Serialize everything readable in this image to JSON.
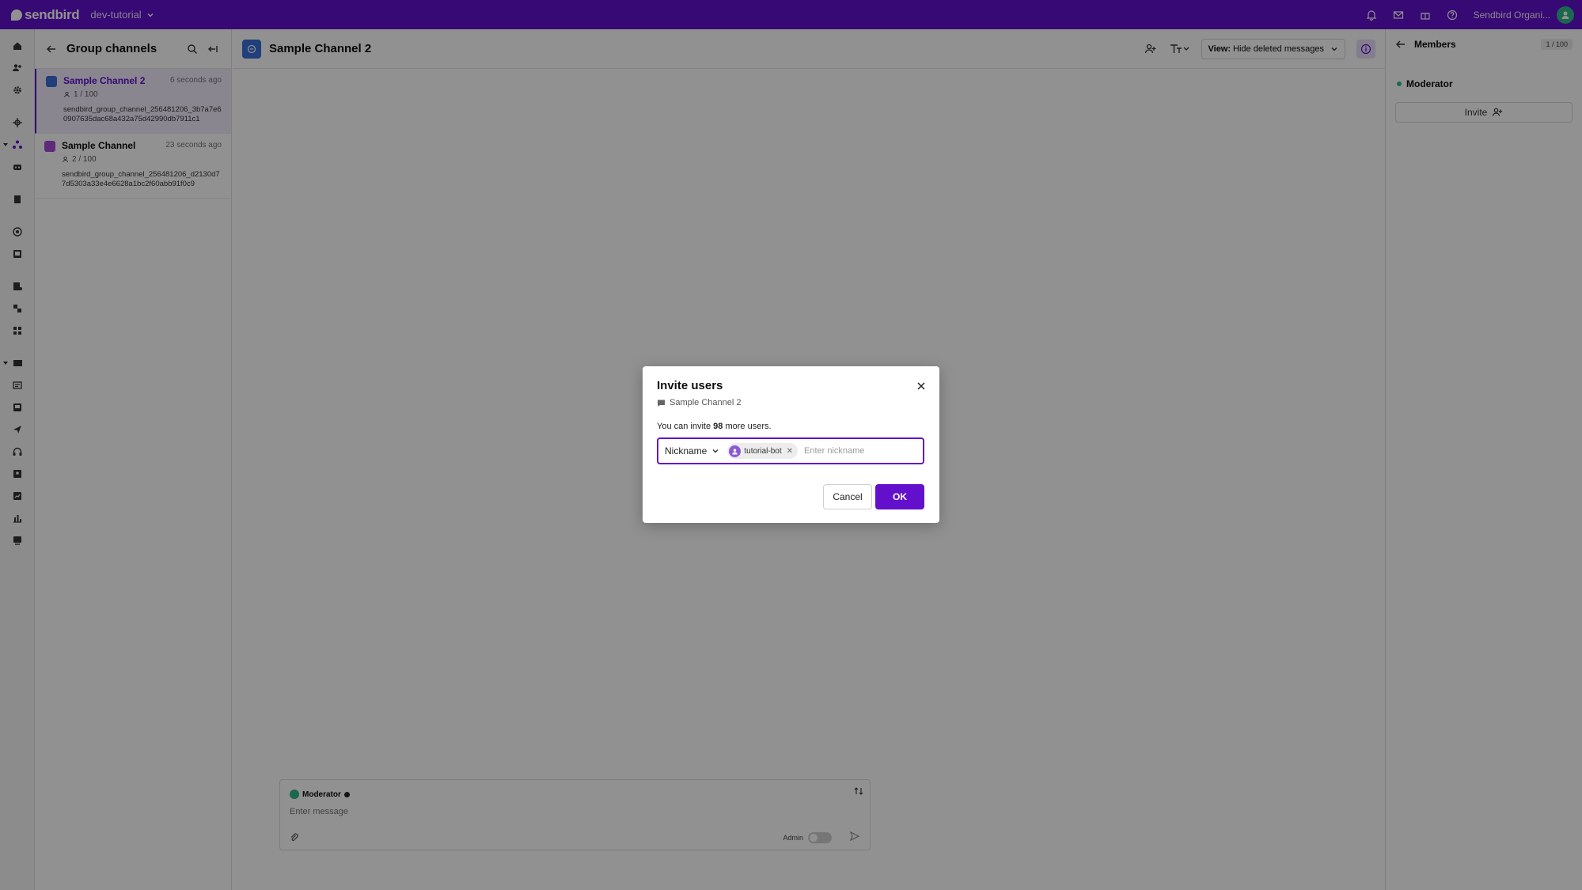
{
  "topbar": {
    "brand": "sendbird",
    "app": "dev-tutorial",
    "org": "Sendbird Organi...",
    "icons": [
      "bell-icon",
      "mail-icon",
      "gift-icon",
      "help-icon"
    ]
  },
  "rail": {
    "icons": [
      "home-icon",
      "users-icon",
      "settings-icon",
      "move-icon",
      "channels-icon",
      "bot-icon",
      "notes-icon",
      "broadcast-icon",
      "media-icon",
      "moderation-icon",
      "flow-icon",
      "apps-icon",
      "tickets-icon",
      "forms-icon",
      "inbox-icon",
      "send-icon",
      "headset-icon",
      "contacts-icon",
      "reports-icon",
      "analytics-icon",
      "desk-icon"
    ]
  },
  "channel_list": {
    "title": "Group channels",
    "items": [
      {
        "name": "Sample Channel 2",
        "time": "6 seconds ago",
        "members": "1 / 100",
        "url": "sendbird_group_channel_256481206_3b7a7e60907635dac68a432a75d42990db7911c1",
        "color": "#3970d9",
        "active": true
      },
      {
        "name": "Sample Channel",
        "time": "23 seconds ago",
        "members": "2 / 100",
        "url": "sendbird_group_channel_256481206_d2130d77d5303a33e4e6628a1bc2f60abb91f0c9",
        "color": "#a54bd6",
        "active": false
      }
    ]
  },
  "main": {
    "title": "Sample Channel 2",
    "view_label": "View:",
    "view_value": "Hide deleted messages",
    "composer": {
      "user": "Moderator",
      "placeholder": "Enter message",
      "admin_label": "Admin"
    }
  },
  "members": {
    "title": "Members",
    "count": "1 / 100",
    "items": [
      {
        "name": "Moderator"
      }
    ],
    "invite_label": "Invite"
  },
  "dialog": {
    "title": "Invite users",
    "channel": "Sample Channel 2",
    "note_prefix": "You can invite ",
    "note_count": "98",
    "note_suffix": " more users.",
    "field_type": "Nickname",
    "chip_label": "tutorial-bot",
    "placeholder": "Enter nickname",
    "cancel_label": "Cancel",
    "ok_label": "OK"
  },
  "colors": {
    "brand": "#6210cc",
    "online": "#2eb88a"
  }
}
